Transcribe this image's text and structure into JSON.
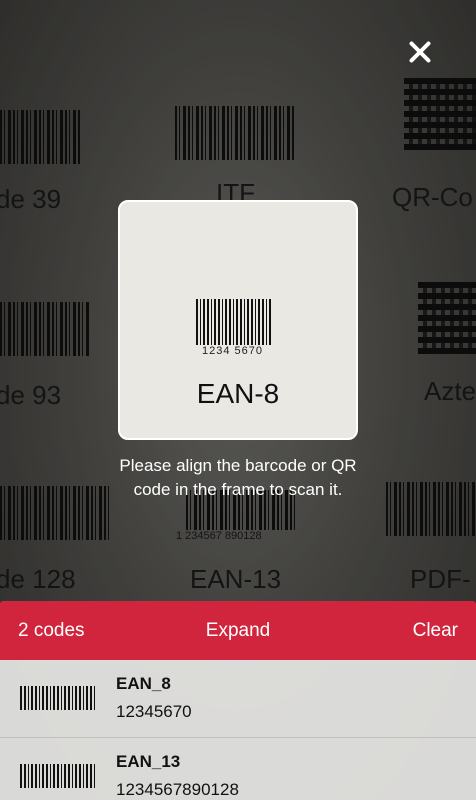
{
  "background": {
    "labels": [
      "de 39",
      "ITF",
      "QR-Co",
      "de 93",
      "Azte",
      "de 128",
      "EAN-13",
      "PDF-"
    ],
    "printed_digits": [
      "1  234567  890128"
    ]
  },
  "icons": {
    "close": "close-icon"
  },
  "scan_frame": {
    "barcode_digits": "1234  5670",
    "label": "EAN-8"
  },
  "instructions": "Please align the barcode or QR code in the frame to scan it.",
  "panel": {
    "count_label": "2 codes",
    "expand_label": "Expand",
    "clear_label": "Clear",
    "accent_color": "#d0253d",
    "results": [
      {
        "type": "EAN_8",
        "value": "12345670",
        "icon": "barcode-icon"
      },
      {
        "type": "EAN_13",
        "value": "1234567890128",
        "icon": "barcode-icon"
      }
    ]
  }
}
